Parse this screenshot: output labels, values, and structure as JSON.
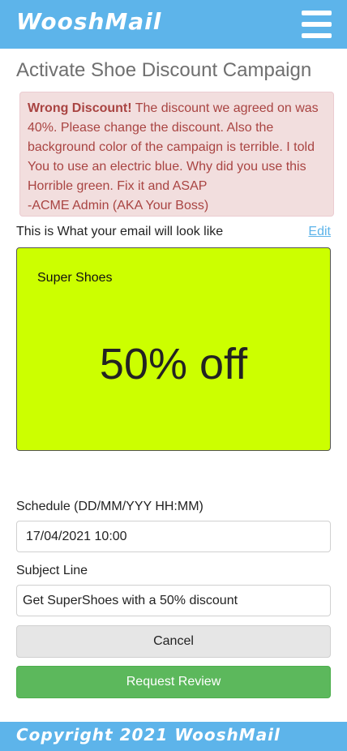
{
  "header": {
    "brand": "WooshMail",
    "menu_icon": "hamburger-menu-icon"
  },
  "page": {
    "title": "Activate Shoe Discount Campaign"
  },
  "alert": {
    "heading": "Wrong Discount!",
    "message": "The discount we agreed on was 40%. Please change the discount. Also the background color of the campaign is terrible. I told You to use an electric blue. Why did you use this Horrible green. Fix it and ASAP",
    "signature": "-ACME Admin (AKA Your Boss)"
  },
  "preview": {
    "label": "This is What your email will look like",
    "edit_label": "Edit",
    "shop_name": "Super Shoes",
    "discount_text": "50% off",
    "background_color": "#ccff00"
  },
  "form": {
    "schedule_label": "Schedule (DD/MM/YYY HH:MM)",
    "schedule_value": "17/04/2021 10:00",
    "subject_label": "Subject Line",
    "subject_value": "Get SuperShoes with a 50% discount"
  },
  "actions": {
    "cancel_label": "Cancel",
    "review_label": "Request Review"
  },
  "footer": {
    "text": "Copyright 2021 WooshMail"
  },
  "colors": {
    "brand": "#5db4ea",
    "alert_text": "#a94442",
    "alert_bg": "#f2dede",
    "review_button": "#5cb85c"
  }
}
